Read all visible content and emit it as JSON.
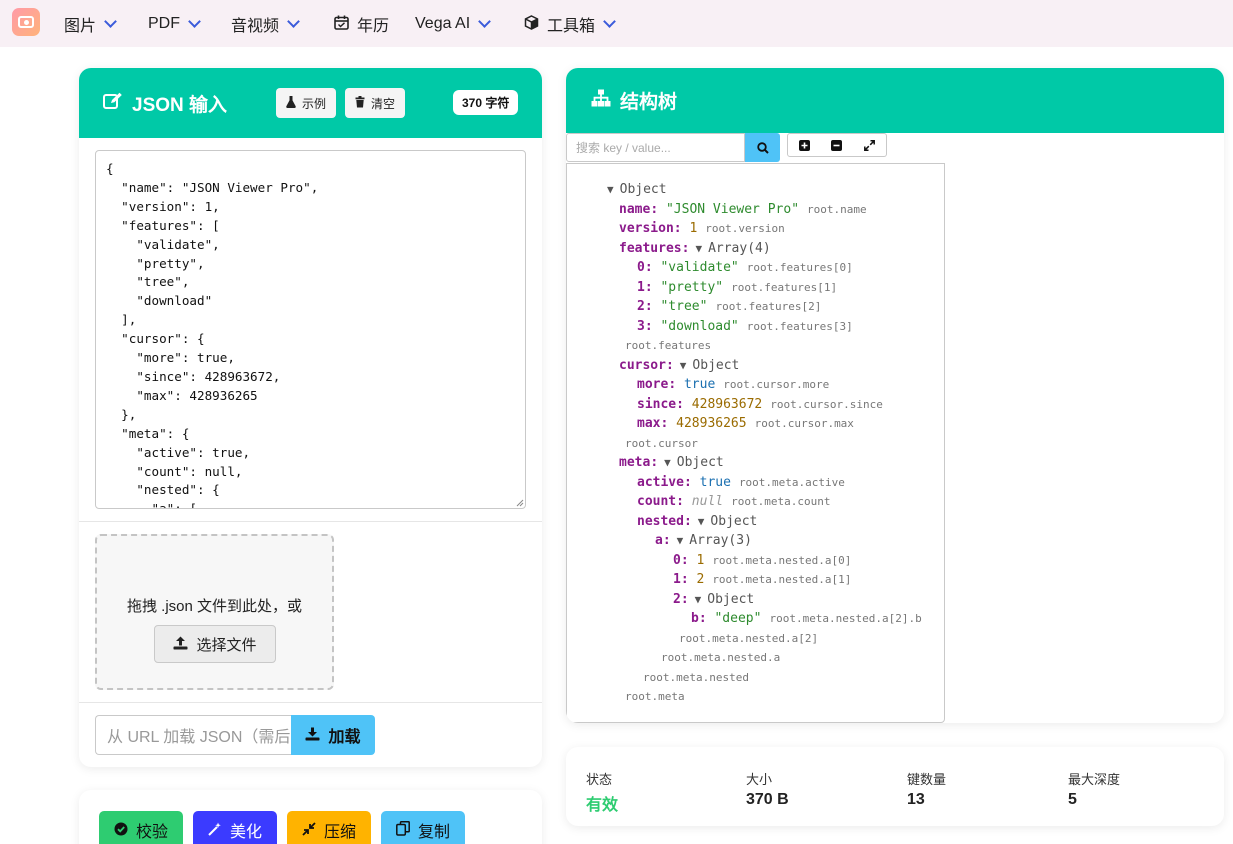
{
  "nav": {
    "items": [
      {
        "label": "图片"
      },
      {
        "label": "PDF"
      },
      {
        "label": "音视频"
      },
      {
        "label": "年历"
      },
      {
        "label": "Vega AI"
      },
      {
        "label": "工具箱"
      }
    ]
  },
  "input_panel": {
    "title": "JSON 输入",
    "example_btn": "示例",
    "clear_btn": "清空",
    "char_count": "370 字符",
    "editor_text": "{\n  \"name\": \"JSON Viewer Pro\",\n  \"version\": 1,\n  \"features\": [\n    \"validate\",\n    \"pretty\",\n    \"tree\",\n    \"download\"\n  ],\n  \"cursor\": {\n    \"more\": true,\n    \"since\": 428963672,\n    \"max\": 428936265\n  },\n  \"meta\": {\n    \"active\": true,\n    \"count\": null,\n    \"nested\": {\n      \"a\": [",
    "dropzone_text": "拖拽 .json 文件到此处，或",
    "choose_file": "选择文件",
    "url_placeholder": "从 URL 加载 JSON（需后端代理）",
    "load_btn": "加载"
  },
  "actions": {
    "validate": "校验",
    "beautify": "美化",
    "minify": "压缩",
    "copy": "复制"
  },
  "tree_panel": {
    "title": "结构树",
    "search_placeholder": "搜索 key / value..."
  },
  "tree": {
    "root_type": "Object",
    "name_key": "name",
    "name_val": "\"JSON Viewer Pro\"",
    "name_path": "root.name",
    "version_key": "version",
    "version_val": "1",
    "version_path": "root.version",
    "features_key": "features",
    "features_type": "Array(4)",
    "f0_key": "0",
    "f0_val": "\"validate\"",
    "f0_path": "root.features[0]",
    "f1_key": "1",
    "f1_val": "\"pretty\"",
    "f1_path": "root.features[1]",
    "f2_key": "2",
    "f2_val": "\"tree\"",
    "f2_path": "root.features[2]",
    "f3_key": "3",
    "f3_val": "\"download\"",
    "f3_path": "root.features[3]",
    "features_path": "root.features",
    "cursor_key": "cursor",
    "cursor_type": "Object",
    "more_key": "more",
    "more_val": "true",
    "more_path": "root.cursor.more",
    "since_key": "since",
    "since_val": "428963672",
    "since_path": "root.cursor.since",
    "max_key": "max",
    "max_val": "428936265",
    "max_path": "root.cursor.max",
    "cursor_path": "root.cursor",
    "meta_key": "meta",
    "meta_type": "Object",
    "active_key": "active",
    "active_val": "true",
    "active_path": "root.meta.active",
    "count_key": "count",
    "count_val": "null",
    "count_path": "root.meta.count",
    "nested_key": "nested",
    "nested_type": "Object",
    "a_key": "a",
    "a_type": "Array(3)",
    "a0_key": "0",
    "a0_val": "1",
    "a0_path": "root.meta.nested.a[0]",
    "a1_key": "1",
    "a1_val": "2",
    "a1_path": "root.meta.nested.a[1]",
    "a2_key": "2",
    "a2_type": "Object",
    "b_key": "b",
    "b_val": "\"deep\"",
    "b_path": "root.meta.nested.a[2].b",
    "a2_path": "root.meta.nested.a[2]",
    "a_path": "root.meta.nested.a",
    "nested_path": "root.meta.nested",
    "meta_path": "root.meta"
  },
  "stats": {
    "status_label": "状态",
    "status_value": "有效",
    "size_label": "大小",
    "size_value": "370 B",
    "keys_label": "键数量",
    "keys_value": "13",
    "depth_label": "最大深度",
    "depth_value": "5"
  },
  "colors": {
    "header_green": "#00c9a7",
    "valid_green": "#2ecc71",
    "btn_validate": "#2ecc71",
    "btn_beautify": "#3b3bff",
    "btn_minify": "#ffb300",
    "btn_copy": "#4fc3f7",
    "load_blue": "#4fc3f7"
  }
}
